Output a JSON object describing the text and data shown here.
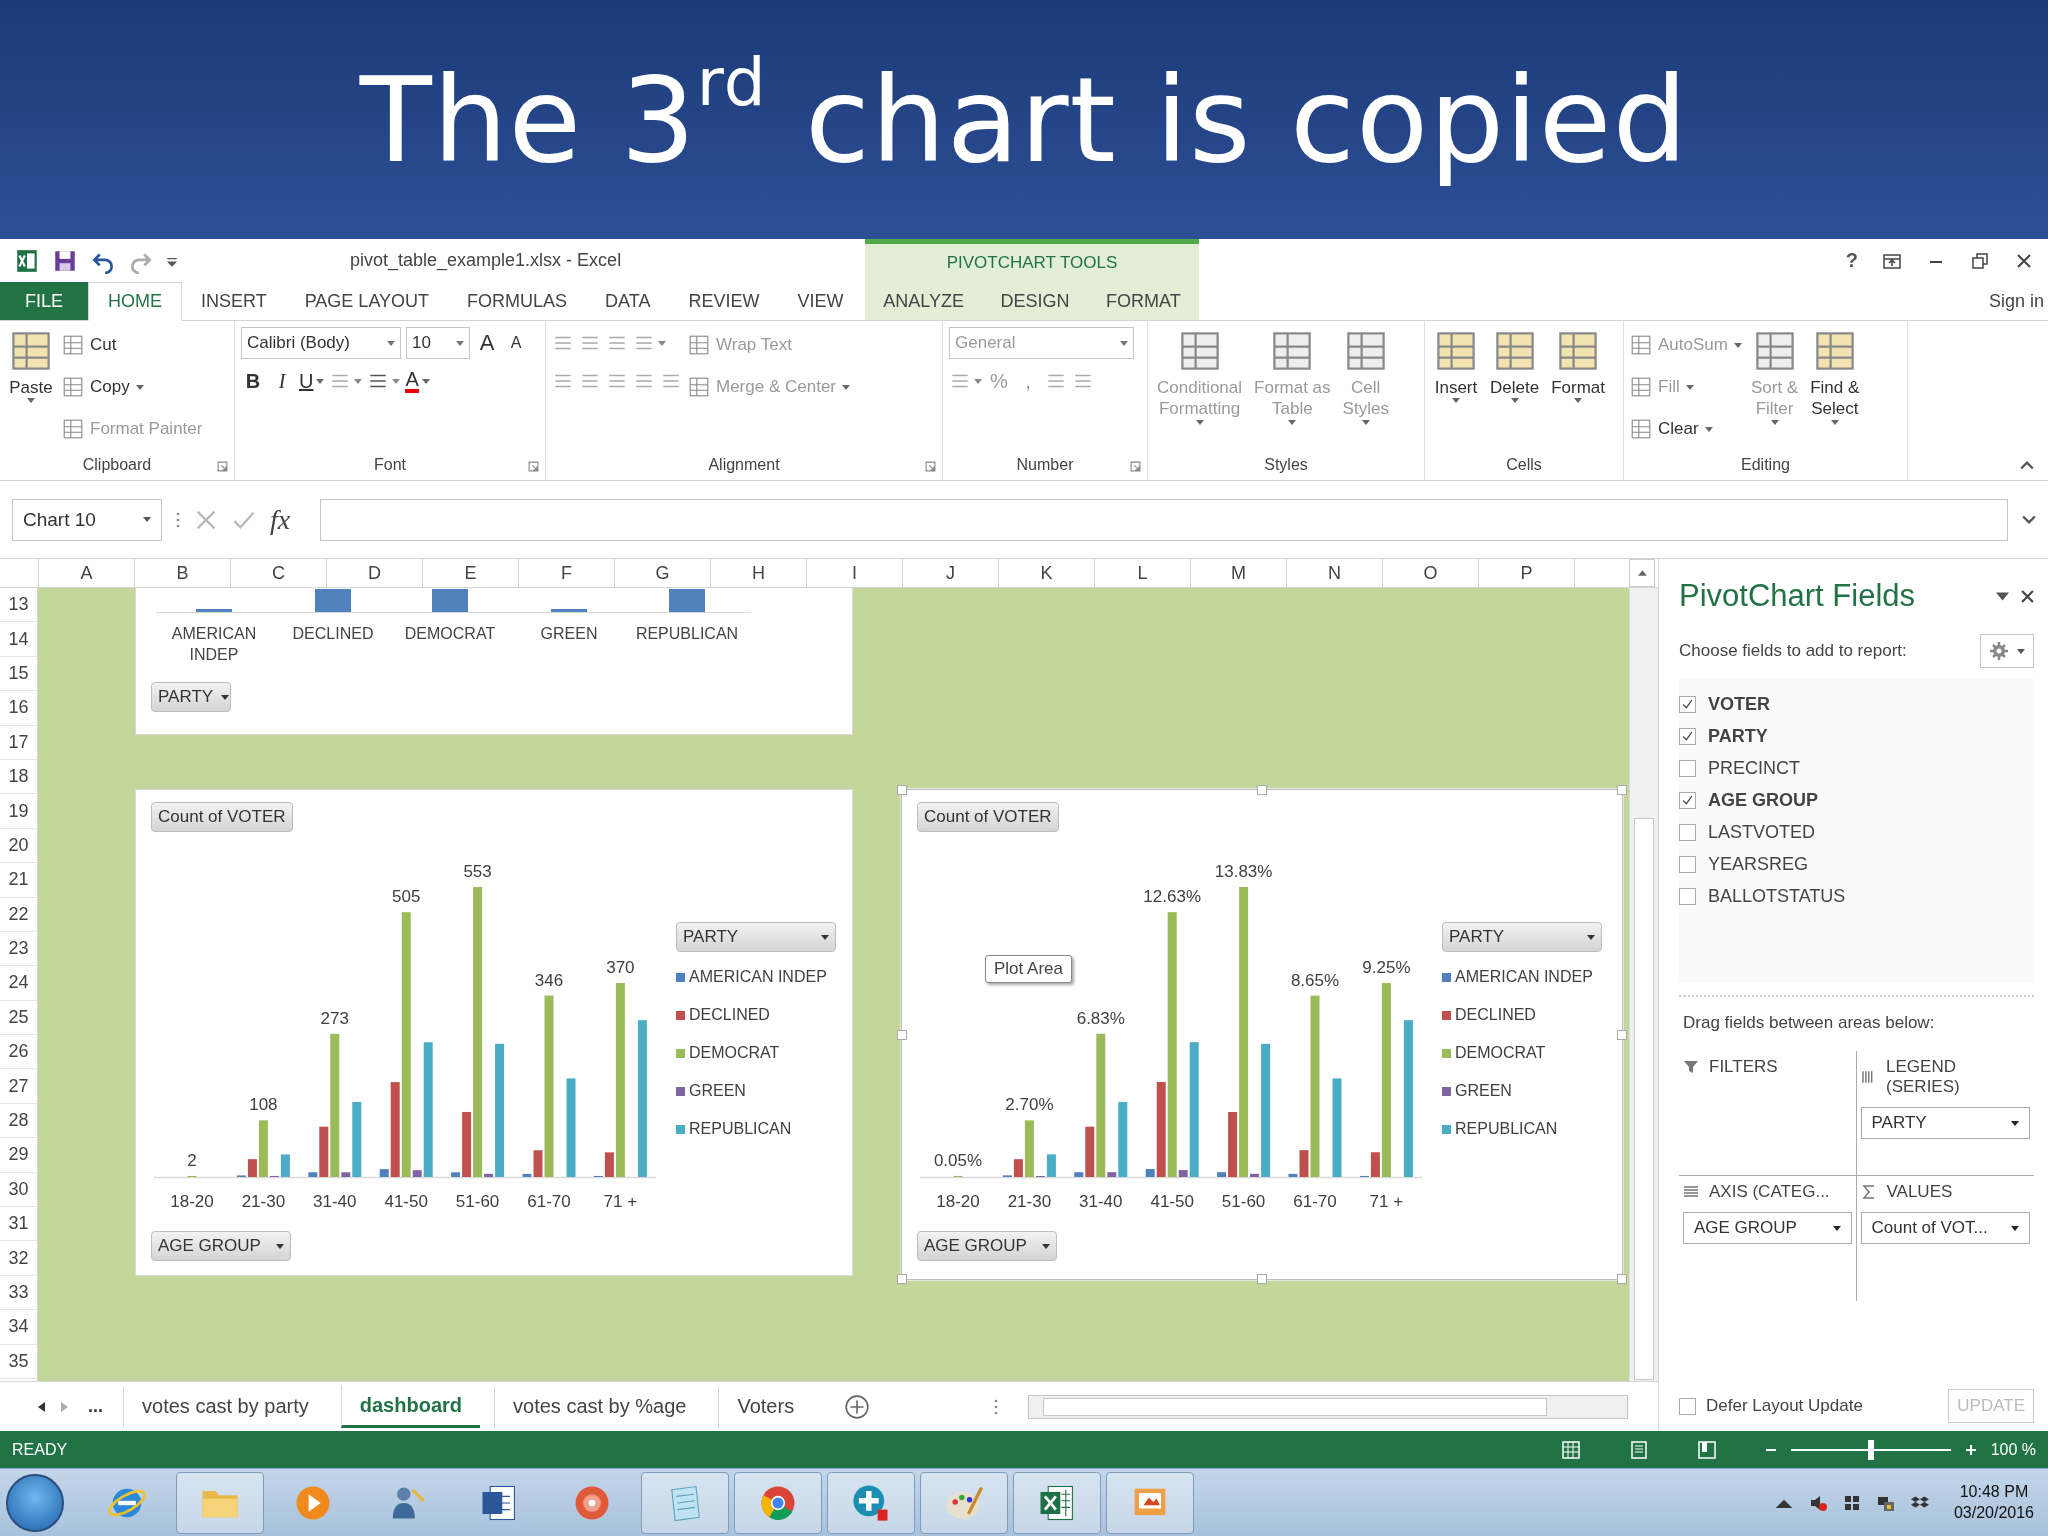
{
  "slide_title": "The 3$^{rd}$ chart is copied",
  "window": {
    "title": "pivot_table_example1.xlsx - Excel",
    "context_header": "PIVOTCHART TOOLS",
    "help": "?",
    "sign_in": "Sign in"
  },
  "ribbon_tabs": [
    {
      "label": "FILE",
      "kind": "file",
      "selected": false
    },
    {
      "label": "HOME",
      "kind": "main",
      "selected": true
    },
    {
      "label": "INSERT",
      "kind": "main",
      "selected": false
    },
    {
      "label": "PAGE LAYOUT",
      "kind": "main",
      "selected": false
    },
    {
      "label": "FORMULAS",
      "kind": "main",
      "selected": false
    },
    {
      "label": "DATA",
      "kind": "main",
      "selected": false
    },
    {
      "label": "REVIEW",
      "kind": "main",
      "selected": false
    },
    {
      "label": "VIEW",
      "kind": "main",
      "selected": false
    },
    {
      "label": "ANALYZE",
      "kind": "context",
      "selected": false
    },
    {
      "label": "DESIGN",
      "kind": "context",
      "selected": false
    },
    {
      "label": "FORMAT",
      "kind": "context",
      "selected": false
    }
  ],
  "ribbon_groups": [
    {
      "label": "Clipboard",
      "launcher": true,
      "cols": [
        [
          [
            {
              "kind": "large",
              "label": "Paste",
              "dropdown": true,
              "disabled": false
            }
          ]
        ],
        [
          [
            {
              "kind": "small",
              "label": "Cut",
              "dropdown": false,
              "disabled": false
            }
          ],
          [
            {
              "kind": "small",
              "label": "Copy",
              "dropdown": true,
              "disabled": false
            }
          ],
          [
            {
              "kind": "small",
              "label": "Format Painter",
              "dropdown": false,
              "disabled": true
            }
          ]
        ]
      ]
    },
    {
      "label": "Font",
      "launcher": true,
      "cols": [
        [
          [
            {
              "kind": "combo",
              "label": "Calibri (Body)",
              "disabled": false
            },
            {
              "kind": "combo",
              "label": "10",
              "disabled": false
            },
            {
              "kind": "glyph",
              "label": "A",
              "dropdown": false,
              "disabled": false
            },
            {
              "kind": "glyph",
              "label": "A",
              "dropdown": false,
              "disabled": false
            }
          ],
          [
            {
              "kind": "glyph",
              "label": "B",
              "dropdown": false,
              "disabled": false
            },
            {
              "kind": "glyph",
              "label": "I",
              "dropdown": false,
              "disabled": false
            },
            {
              "kind": "glyph",
              "label": "U",
              "dropdown": true,
              "disabled": false
            },
            {
              "kind": "icon",
              "dropdown": true,
              "disabled": true
            },
            {
              "kind": "icon",
              "dropdown": true,
              "disabled": false
            },
            {
              "kind": "glyph",
              "label": "A",
              "dropdown": true,
              "disabled": false
            }
          ]
        ]
      ]
    },
    {
      "label": "Alignment",
      "launcher": true,
      "cols": [
        [
          [
            {
              "kind": "icon",
              "dropdown": false,
              "disabled": true
            },
            {
              "kind": "icon",
              "dropdown": false,
              "disabled": true
            },
            {
              "kind": "icon",
              "dropdown": false,
              "disabled": true
            },
            {
              "kind": "icon",
              "dropdown": true,
              "disabled": true
            }
          ],
          [
            {
              "kind": "icon",
              "dropdown": false,
              "disabled": true
            },
            {
              "kind": "icon",
              "dropdown": false,
              "disabled": true
            },
            {
              "kind": "icon",
              "dropdown": false,
              "disabled": true
            },
            {
              "kind": "icon",
              "dropdown": false,
              "disabled": true
            },
            {
              "kind": "icon",
              "dropdown": false,
              "disabled": true
            }
          ]
        ],
        [
          [
            {
              "kind": "small",
              "label": "Wrap Text",
              "dropdown": false,
              "disabled": true
            }
          ],
          [
            {
              "kind": "small",
              "label": "Merge & Center",
              "dropdown": true,
              "disabled": true
            }
          ]
        ]
      ]
    },
    {
      "label": "Number",
      "launcher": true,
      "cols": [
        [
          [
            {
              "kind": "combo",
              "label": "General",
              "disabled": true
            }
          ],
          [
            {
              "kind": "icon",
              "dropdown": true,
              "disabled": true
            },
            {
              "kind": "glyph",
              "label": "%",
              "dropdown": false,
              "disabled": true
            },
            {
              "kind": "glyph",
              "label": ",",
              "dropdown": false,
              "disabled": true
            },
            {
              "kind": "icon",
              "dropdown": false,
              "disabled": true
            },
            {
              "kind": "icon",
              "dropdown": false,
              "disabled": true
            }
          ]
        ]
      ]
    },
    {
      "label": "Styles",
      "launcher": false,
      "cols": [
        [
          [
            {
              "kind": "large",
              "label": "Conditional\nFormatting",
              "dropdown": true,
              "disabled": true
            }
          ]
        ],
        [
          [
            {
              "kind": "large",
              "label": "Format as\nTable",
              "dropdown": true,
              "disabled": true
            }
          ]
        ],
        [
          [
            {
              "kind": "large",
              "label": "Cell\nStyles",
              "dropdown": true,
              "disabled": true
            }
          ]
        ]
      ]
    },
    {
      "label": "Cells",
      "launcher": false,
      "cols": [
        [
          [
            {
              "kind": "large",
              "label": "Insert",
              "dropdown": true,
              "disabled": false
            }
          ]
        ],
        [
          [
            {
              "kind": "large",
              "label": "Delete",
              "dropdown": true,
              "disabled": false
            }
          ]
        ],
        [
          [
            {
              "kind": "large",
              "label": "Format",
              "dropdown": true,
              "disabled": false
            }
          ]
        ]
      ]
    },
    {
      "label": "Editing",
      "launcher": false,
      "cols": [
        [
          [
            {
              "kind": "small",
              "label": "AutoSum",
              "dropdown": true,
              "disabled": true
            }
          ],
          [
            {
              "kind": "small",
              "label": "Fill",
              "dropdown": true,
              "disabled": true
            }
          ],
          [
            {
              "kind": "small",
              "label": "Clear",
              "dropdown": true,
              "disabled": false
            }
          ]
        ],
        [
          [
            {
              "kind": "large",
              "label": "Sort &\nFilter",
              "dropdown": true,
              "disabled": true
            }
          ]
        ],
        [
          [
            {
              "kind": "large",
              "label": "Find &\nSelect",
              "dropdown": true,
              "disabled": false
            }
          ]
        ]
      ]
    }
  ],
  "name_box": "Chart 10",
  "formula_fx": "fx",
  "columns": [
    "A",
    "B",
    "C",
    "D",
    "E",
    "F",
    "G",
    "H",
    "I",
    "J",
    "K",
    "L",
    "M",
    "N",
    "O",
    "P"
  ],
  "rows": [
    "13",
    "14",
    "15",
    "16",
    "17",
    "18",
    "19",
    "20",
    "21",
    "22",
    "23",
    "24",
    "25",
    "26",
    "27",
    "28",
    "29",
    "30",
    "31",
    "32",
    "33",
    "34",
    "35"
  ],
  "charts": [
    {
      "kind": "partial",
      "selected": false,
      "axis_button": "PARTY",
      "categories": [
        "AMERICAN INDEP",
        "DECLINED",
        "DEMOCRAT",
        "GREEN",
        "REPUBLICAN"
      ]
    },
    {
      "kind": "full",
      "selected": false,
      "value_button": "Count of VOTER",
      "axis_button": "AGE GROUP",
      "legend_button": "PARTY",
      "chart_data": {
        "type": "bar",
        "categories": [
          "18-20",
          "21-30",
          "31-40",
          "41-50",
          "51-60",
          "61-70",
          "71 +"
        ],
        "series": [
          {
            "name": "AMERICAN INDEP",
            "color": "#4f81bd",
            "values": [
              0,
              3,
              9,
              15,
              9,
              6,
              2
            ]
          },
          {
            "name": "DECLINED",
            "color": "#c0504d",
            "values": [
              0,
              34,
              96,
              181,
              124,
              51,
              47
            ]
          },
          {
            "name": "DEMOCRAT",
            "color": "#9bbb59",
            "values": [
              2,
              108,
              273,
              505,
              553,
              346,
              370
            ],
            "value_labels": [
              "2",
              "108",
              "273",
              "505",
              "553",
              "346",
              "370"
            ]
          },
          {
            "name": "GREEN",
            "color": "#8064a2",
            "values": [
              0,
              2,
              9,
              13,
              6,
              0,
              0
            ]
          },
          {
            "name": "REPUBLICAN",
            "color": "#4bacc6",
            "values": [
              0,
              43,
              143,
              257,
              254,
              188,
              299
            ]
          }
        ]
      }
    },
    {
      "kind": "full",
      "selected": true,
      "value_button": "Count of VOTER",
      "axis_button": "AGE GROUP",
      "legend_button": "PARTY",
      "tooltip": "Plot Area",
      "chart_data": {
        "type": "bar",
        "categories": [
          "18-20",
          "21-30",
          "31-40",
          "41-50",
          "51-60",
          "61-70",
          "71 +"
        ],
        "series": [
          {
            "name": "AMERICAN INDEP",
            "color": "#4f81bd",
            "values": [
              0,
              0.08,
              0.23,
              0.38,
              0.23,
              0.15,
              0.05
            ]
          },
          {
            "name": "DECLINED",
            "color": "#c0504d",
            "values": [
              0,
              0.85,
              2.4,
              4.53,
              3.1,
              1.28,
              1.18
            ]
          },
          {
            "name": "DEMOCRAT",
            "color": "#9bbb59",
            "values": [
              0.05,
              2.7,
              6.83,
              12.63,
              13.83,
              8.65,
              9.25
            ],
            "value_labels": [
              "0.05%",
              "2.70%",
              "6.83%",
              "12.63%",
              "13.83%",
              "8.65%",
              "9.25%"
            ]
          },
          {
            "name": "GREEN",
            "color": "#8064a2",
            "values": [
              0,
              0.05,
              0.23,
              0.33,
              0.15,
              0,
              0
            ]
          },
          {
            "name": "REPUBLICAN",
            "color": "#4bacc6",
            "values": [
              0,
              1.08,
              3.58,
              6.43,
              6.35,
              4.7,
              7.48
            ]
          }
        ]
      }
    }
  ],
  "sheet_tabs": {
    "more": "...",
    "tabs": [
      {
        "label": "votes cast by party",
        "selected": false
      },
      {
        "label": "dashboard",
        "selected": true
      },
      {
        "label": "votes cast by %age",
        "selected": false
      },
      {
        "label": "Voters",
        "selected": false
      }
    ]
  },
  "pivot_panel": {
    "title": "PivotChart Fields",
    "prompt": "Choose fields to add to report:",
    "fields": [
      {
        "label": "VOTER",
        "checked": true
      },
      {
        "label": "PARTY",
        "checked": true
      },
      {
        "label": "PRECINCT",
        "checked": false
      },
      {
        "label": "AGE GROUP",
        "checked": true
      },
      {
        "label": "LASTVOTED",
        "checked": false
      },
      {
        "label": "YEARSREG",
        "checked": false
      },
      {
        "label": "BALLOTSTATUS",
        "checked": false
      }
    ],
    "drag_hint": "Drag fields between areas below:",
    "areas": [
      {
        "label": "FILTERS",
        "kind": "filters"
      },
      {
        "label": "LEGEND (SERIES)",
        "kind": "legend",
        "items": [
          "PARTY"
        ]
      },
      {
        "label": "AXIS (CATEG...",
        "kind": "axis",
        "items": [
          "AGE GROUP"
        ]
      },
      {
        "label": "VALUES",
        "kind": "values",
        "items": [
          "Count of VOT..."
        ]
      }
    ],
    "defer": {
      "label": "Defer Layout Update",
      "checked": false
    },
    "update_button": {
      "label": "UPDATE",
      "disabled": true
    }
  },
  "status": {
    "text": "READY",
    "zoom": {
      "level": 0.5,
      "label": "100 %"
    }
  },
  "taskbar": {
    "apps": [
      {
        "kind": "ie",
        "running": false
      },
      {
        "kind": "folder",
        "running": true
      },
      {
        "kind": "media",
        "running": false
      },
      {
        "kind": "person",
        "running": false
      },
      {
        "kind": "word",
        "running": false
      },
      {
        "kind": "disc",
        "running": false
      },
      {
        "kind": "notepad",
        "running": true
      },
      {
        "kind": "chrome",
        "running": true
      },
      {
        "kind": "plus",
        "running": true
      },
      {
        "kind": "palette",
        "running": true
      },
      {
        "kind": "excel",
        "running": true
      },
      {
        "kind": "slides",
        "running": true
      }
    ],
    "time": "10:48 PM",
    "date": "03/20/2016"
  }
}
